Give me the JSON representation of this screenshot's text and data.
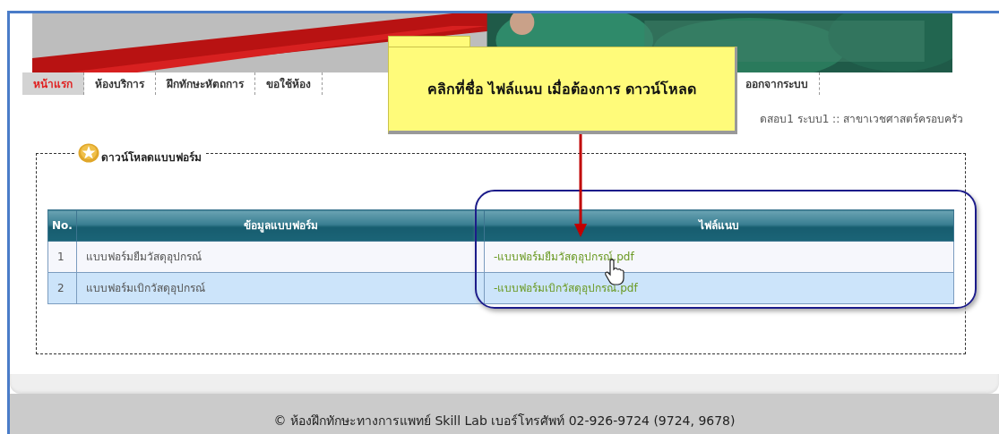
{
  "menu": [
    {
      "label": "หน้าแรก",
      "selected": true
    },
    {
      "label": "ห้องบริการ",
      "selected": false
    },
    {
      "label": "ฝึกทักษะหัตถการ",
      "selected": false
    },
    {
      "label": "ขอใช้ห้อง",
      "selected": false
    },
    {
      "label": "ออกจากระบบ",
      "selected": false
    }
  ],
  "breadcrumb": "ดสอบ1 ระบบ1 :: สาขาเวชศาสตร์ครอบครัว",
  "callout": "คลิกที่ชื่อ ไฟล์แนบ เมื่อต้องการ ดาวน์โหลด",
  "panel": {
    "title": "ดาวน์โหลดแบบฟอร์ม"
  },
  "table": {
    "columns": [
      "No.",
      "ข้อมูลแบบฟอร์ม",
      "ไฟล์แนบ"
    ],
    "rows": [
      {
        "no": "1",
        "info": "แบบฟอร์มยืมวัสดุอุปกรณ์",
        "file": "-แบบฟอร์มยืมวัสดุอุปกรณ์.pdf"
      },
      {
        "no": "2",
        "info": "แบบฟอร์มเบิกวัสดุอุปกรณ์",
        "file": "-แบบฟอร์มเบิกวัสดุอุปกรณ์.pdf"
      }
    ]
  },
  "footer": "© ห้องฝึกทักษะทางการแพทย์ Skill Lab เบอร์โทรศัพท์ 02-926-9724 (9724, 9678)"
}
